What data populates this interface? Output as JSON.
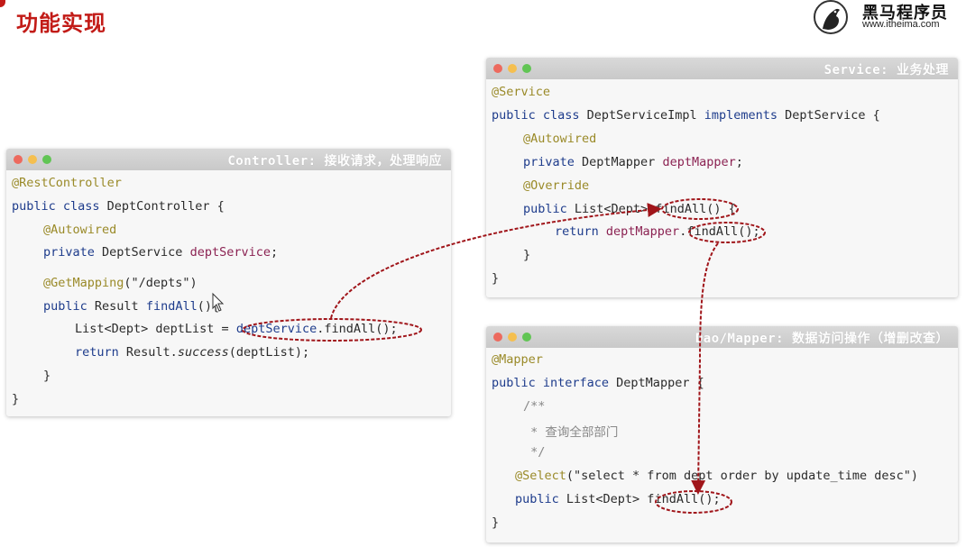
{
  "slide": {
    "title": "功能实现",
    "page_number": ""
  },
  "logo": {
    "name": "黑马程序员",
    "url": "www.itheima.com"
  },
  "colors": {
    "title_red": "#c21b17",
    "annotation_red": "#a0151a",
    "panel_bg": "#f7f7f7"
  },
  "controller": {
    "title": "Controller: 接收请求，处理响应",
    "lines": {
      "l1": "@RestController",
      "l2a": "public class ",
      "l2b": "DeptController {",
      "l3": "@Autowired",
      "l4a": "private ",
      "l4b": "DeptService ",
      "l4c": "deptService",
      "l4d": ";",
      "l5a": "@GetMapping",
      "l5b": "(\"/depts\")",
      "l6a": "public ",
      "l6b": "Result ",
      "l6c": "findAll",
      "l6d": "(){",
      "l7a": "List<Dept> deptList = ",
      "l7b": "deptService",
      "l7c": ".findAll();",
      "l8a": "return ",
      "l8b": "Result.",
      "l8c": "success",
      "l8d": "(deptList);",
      "l9": "}",
      "l10": "}"
    }
  },
  "service": {
    "title": "Service: 业务处理",
    "lines": {
      "l1": "@Service",
      "l2a": "public class ",
      "l2b": "DeptServiceImpl ",
      "l2c": "implements ",
      "l2d": "DeptService {",
      "l3": "@Autowired",
      "l4a": "private ",
      "l4b": "DeptMapper ",
      "l4c": "deptMapper",
      "l4d": ";",
      "l5": "@Override",
      "l6a": "public ",
      "l6b": "List<Dept> findAll() {",
      "l7a": "return ",
      "l7b": "deptMapper",
      "l7c": ".findAll();",
      "l8": "}",
      "l9": "}"
    }
  },
  "mapper": {
    "title": "Dao/Mapper: 数据访问操作（增删改查）",
    "lines": {
      "l1": "@Mapper",
      "l2a": "public interface ",
      "l2b": "DeptMapper {",
      "l3": "/**",
      "l4": " * 查询全部部门",
      "l5": " */",
      "l6a": "@Select",
      "l6b": "(\"select * from dept order by update_time desc\")",
      "l7a": "public ",
      "l7b": "List<Dept> findAll();",
      "l8": "}"
    }
  }
}
